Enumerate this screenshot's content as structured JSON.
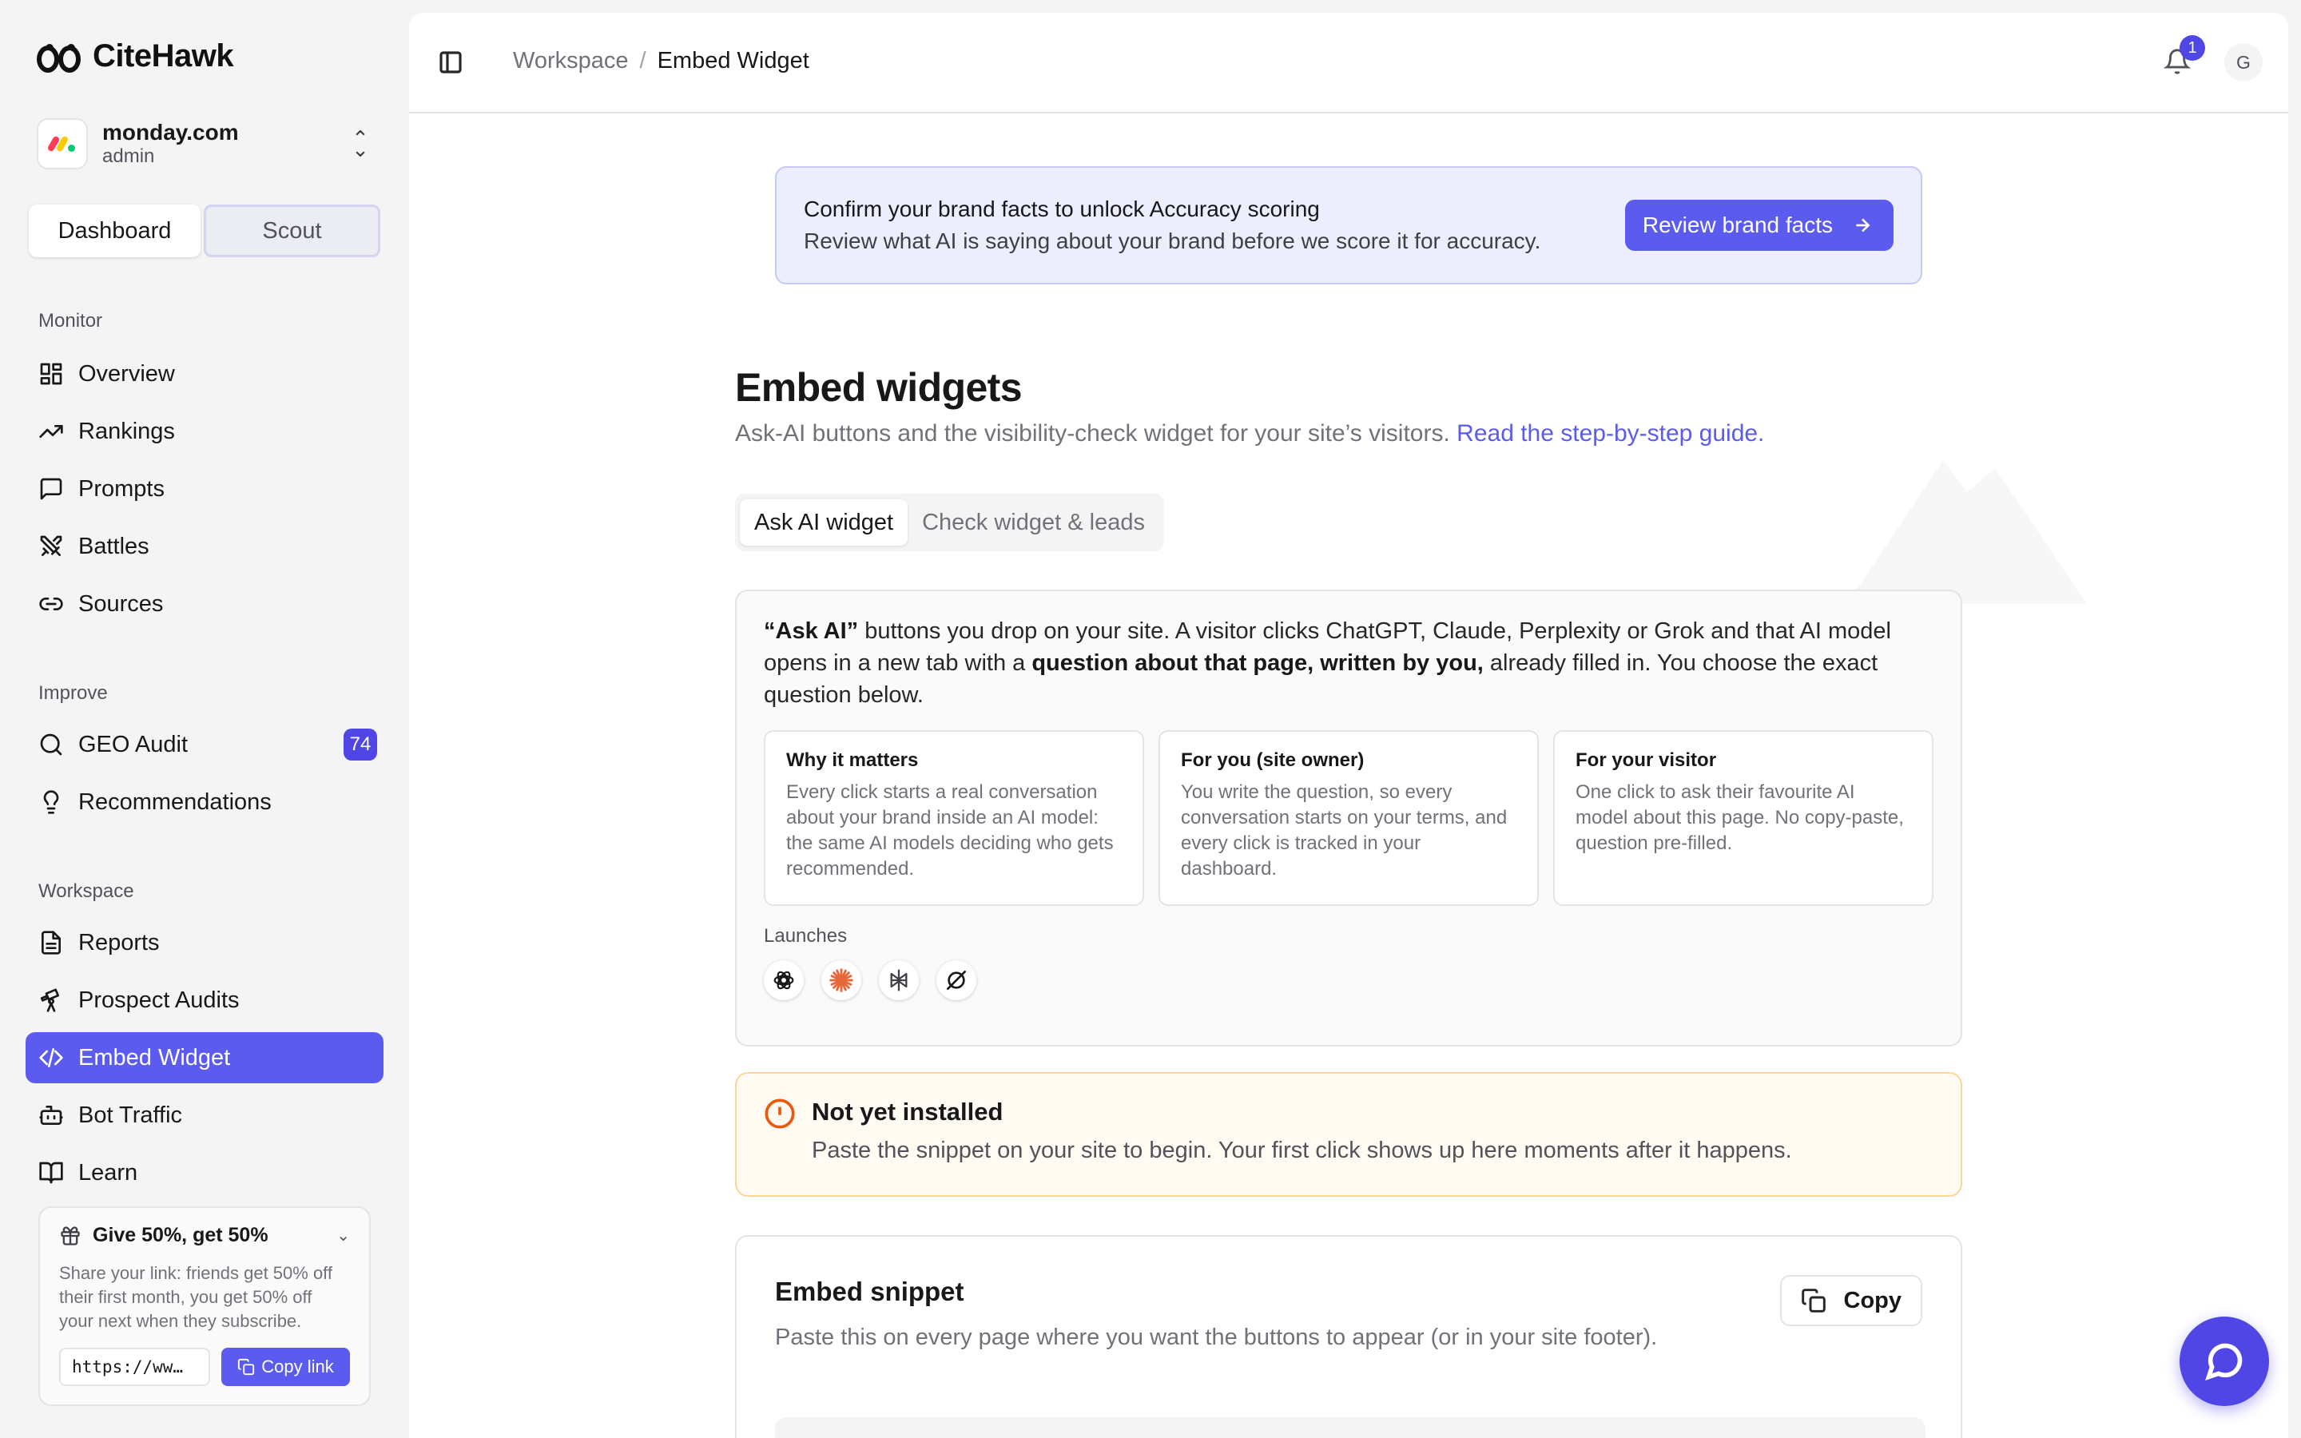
{
  "app": {
    "name": "CiteHawk"
  },
  "org": {
    "name": "monday.com",
    "role": "admin"
  },
  "mode_switch": {
    "options": [
      "Dashboard",
      "Scout"
    ],
    "selected": "Dashboard"
  },
  "sidebar": {
    "groups": [
      {
        "label": "Monitor",
        "items": [
          {
            "label": "Overview",
            "icon": "grid-icon"
          },
          {
            "label": "Rankings",
            "icon": "trending-up-icon"
          },
          {
            "label": "Prompts",
            "icon": "message-square-icon"
          },
          {
            "label": "Battles",
            "icon": "swords-icon"
          },
          {
            "label": "Sources",
            "icon": "link-icon"
          }
        ]
      },
      {
        "label": "Improve",
        "items": [
          {
            "label": "GEO Audit",
            "icon": "search-icon",
            "badge": "74"
          },
          {
            "label": "Recommendations",
            "icon": "lightbulb-icon"
          }
        ]
      },
      {
        "label": "Workspace",
        "items": [
          {
            "label": "Reports",
            "icon": "file-text-icon"
          },
          {
            "label": "Prospect Audits",
            "icon": "telescope-icon"
          },
          {
            "label": "Embed Widget",
            "icon": "code-icon",
            "active": true
          },
          {
            "label": "Bot Traffic",
            "icon": "bot-icon"
          },
          {
            "label": "Learn",
            "icon": "book-open-icon"
          }
        ]
      }
    ],
    "referral": {
      "title": "Give 50%, get 50%",
      "description": "Share your link: friends get 50% off their first month, you get 50% off your next when they subscribe.",
      "link_value": "https://ww…",
      "copy_label": "Copy link"
    }
  },
  "header": {
    "breadcrumb": [
      "Workspace",
      "Embed Widget"
    ],
    "notification_count": "1",
    "user_initial": "G"
  },
  "banner": {
    "title": "Confirm your brand facts to unlock Accuracy scoring",
    "text": "Review what AI is saying about your brand before we score it for accuracy.",
    "button": "Review brand facts"
  },
  "page": {
    "title": "Embed widgets",
    "subtitle": "Ask-AI buttons and the visibility-check widget for your site’s visitors.",
    "guide_link": "Read the step-by-step guide."
  },
  "tabs": {
    "items": [
      "Ask AI widget",
      "Check widget & leads"
    ],
    "selected": "Ask AI widget"
  },
  "ask_ai_card": {
    "intro_1": "“Ask AI”",
    "intro_2": " buttons you drop on your site. A visitor clicks ChatGPT, Claude, Perplexity or Grok and that AI model opens in a new tab with a ",
    "intro_3": "question about that page, written by you,",
    "intro_4": " already filled in. You choose the exact question below.",
    "columns": [
      {
        "title": "Why it matters",
        "text": "Every click starts a real conversation about your brand inside an AI model: the same AI models deciding who gets recommended."
      },
      {
        "title": "For you (site owner)",
        "text": "You write the question, so every conversation starts on your terms, and every click is tracked in your dashboard."
      },
      {
        "title": "For your visitor",
        "text": "One click to ask their favourite AI model about this page. No copy-paste, question pre-filled."
      }
    ],
    "launches_label": "Launches",
    "launches": [
      "chatgpt-icon",
      "claude-icon",
      "perplexity-icon",
      "grok-icon"
    ]
  },
  "install_status": {
    "title": "Not yet installed",
    "text": "Paste the snippet on your site to begin. Your first click shows up here moments after it happens."
  },
  "snippet": {
    "title": "Embed snippet",
    "description": "Paste this on every page where you want the buttons to appear (or in your site footer).",
    "copy_label": "Copy"
  },
  "colors": {
    "accent": "#5b5bf0",
    "warning": "#ea580c",
    "claude": "#e4683a"
  }
}
